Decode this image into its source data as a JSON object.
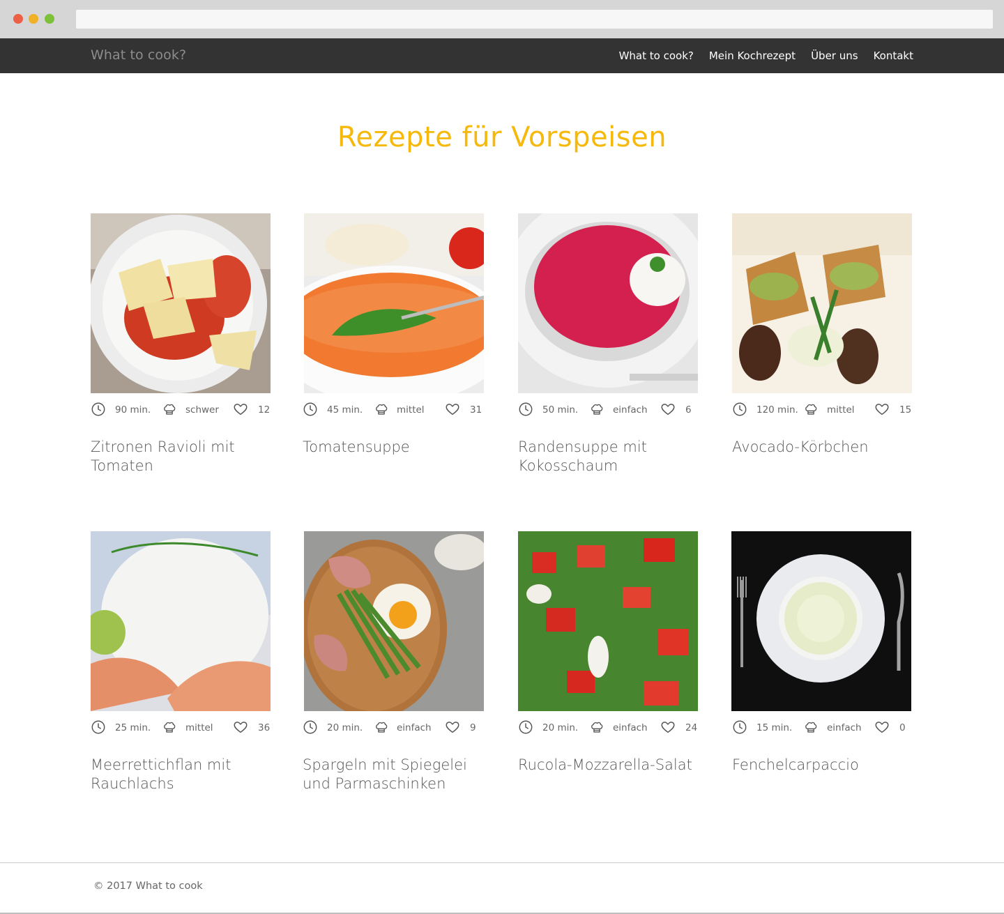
{
  "nav": {
    "brand": "What to cook?",
    "links": [
      "What to cook?",
      "Mein Kochrezept",
      "Über uns",
      "Kontakt"
    ]
  },
  "page": {
    "title": "Rezepte für Vorspeisen"
  },
  "recipes": [
    {
      "title": "Zitronen Ravioli mit Tomaten",
      "time": "90 min.",
      "difficulty": "schwer",
      "likes": "12",
      "image": "ravioli-image"
    },
    {
      "title": "Tomatensuppe",
      "time": "45 min.",
      "difficulty": "mittel",
      "likes": "31",
      "image": "tomato-soup-image"
    },
    {
      "title": "Randensuppe mit Kokosschaum",
      "time": "50 min.",
      "difficulty": "einfach",
      "likes": "6",
      "image": "beet-soup-image"
    },
    {
      "title": "Avocado-Körbchen",
      "time": "120 min.",
      "difficulty": "mittel",
      "likes": "15",
      "image": "avocado-baskets-image"
    },
    {
      "title": "Meerrettichflan mit Rauchlachs",
      "time": "25 min.",
      "difficulty": "mittel",
      "likes": "36",
      "image": "flan-salmon-image"
    },
    {
      "title": "Spargeln mit Spiegelei und Parmaschinken",
      "time": "20 min.",
      "difficulty": "einfach",
      "likes": "9",
      "image": "asparagus-egg-image"
    },
    {
      "title": "Rucola-Mozzarella-Salat",
      "time": "20 min.",
      "difficulty": "einfach",
      "likes": "24",
      "image": "rucola-salad-image"
    },
    {
      "title": "Fenchelcarpaccio",
      "time": "15 min.",
      "difficulty": "einfach",
      "likes": "0",
      "image": "fennel-carpaccio-image"
    }
  ],
  "footer": {
    "copyright": "© 2017 What to cook"
  },
  "colors": {
    "accent": "#f6b80a",
    "navbar": "#333333"
  }
}
